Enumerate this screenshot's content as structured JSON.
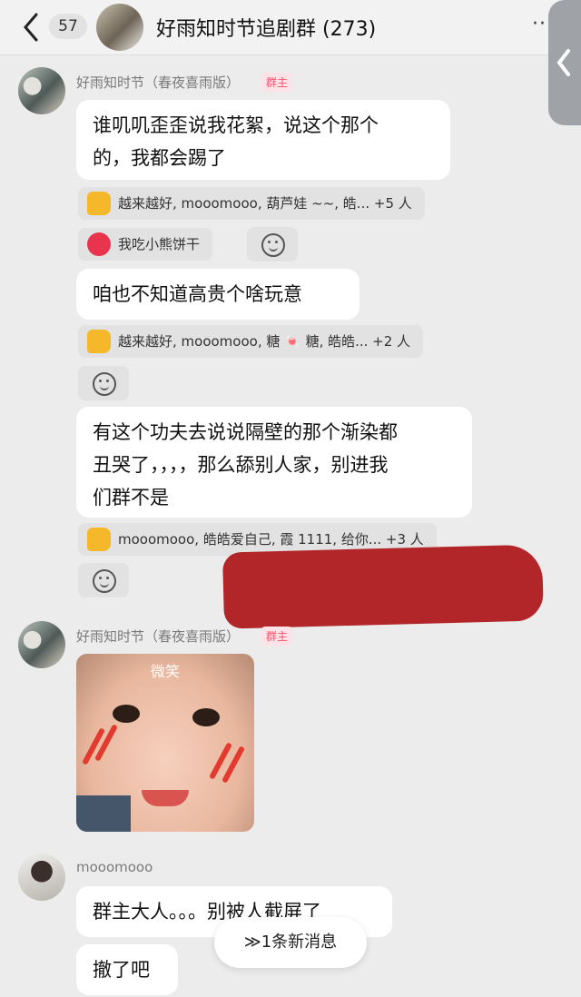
{
  "header": {
    "unread_count": "57",
    "title": "好雨知时节追剧群 (273)",
    "more": "··"
  },
  "messages": [
    {
      "sender": "好雨知时节（春夜喜雨版）",
      "role_tag": "群主",
      "text_lines": [
        "谁叽叽歪歪说我花絮，说这个那个",
        "的，我都会踢了"
      ],
      "reactions": [
        {
          "icon": "thumbs-up-icon",
          "text": "越来越好, mooomooo, 葫芦娃 ~~, 皓... +5 人"
        },
        {
          "icon": "heart-icon",
          "text": "我吃小熊饼干"
        }
      ]
    },
    {
      "text_lines": [
        "咱也不知道高贵个啥玩意"
      ],
      "reactions": [
        {
          "icon": "thumbs-up-icon",
          "text": "越来越好, mooomooo, 糖 🍬 糖, 皓皓... +2 人"
        }
      ]
    },
    {
      "text_lines": [
        "有这个功夫去说说隔壁的那个渐染都",
        "丑哭了，，，，那么舔别人家，别进我",
        "们群不是"
      ],
      "reactions": [
        {
          "icon": "thumbs-up-icon",
          "text": "mooomooo, 皓皓爱自己, 霞 1111, 给你... +3 人"
        }
      ]
    },
    {
      "sender": "好雨知时节（春夜喜雨版）",
      "role_tag": "群主",
      "sticker_caption": "微笑"
    },
    {
      "sender": "mooomooo",
      "text_lines": [
        "群主大人。。。别被人截屏了"
      ]
    },
    {
      "text_lines": [
        "撤了吧"
      ]
    }
  ],
  "new_message_pill": "≫1条新消息",
  "colors": {
    "background": "#ececec",
    "tag": "#ff4d6a",
    "thumb": "#f6b82b",
    "heart": "#e8344c"
  }
}
